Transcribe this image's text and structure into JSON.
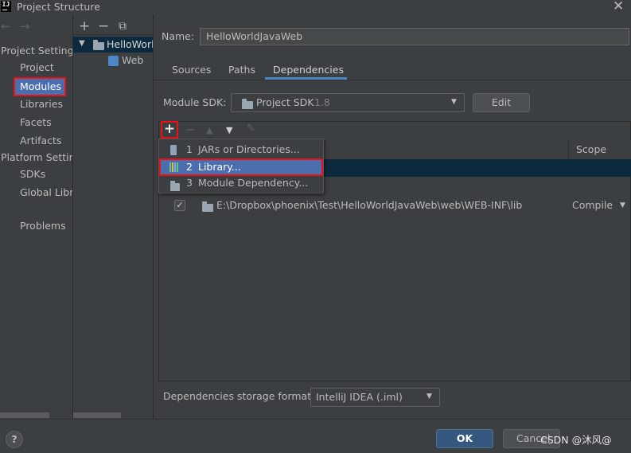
{
  "window": {
    "title": "Project Structure",
    "app_icon_text": "IJ"
  },
  "sidebar": {
    "project_settings_header": "Project Settings",
    "project_settings_items": [
      "Project",
      "Modules",
      "Libraries",
      "Facets",
      "Artifacts"
    ],
    "platform_settings_header": "Platform Settings",
    "platform_settings_items": [
      "SDKs",
      "Global Libraries"
    ],
    "problems": "Problems"
  },
  "tree": {
    "toolbar": {
      "add": "+",
      "remove": "−",
      "copy": "⧉"
    },
    "module": "HelloWorldJavaWeb",
    "child": "Web"
  },
  "main": {
    "name_label": "Name:",
    "name_value": "HelloWorldJavaWeb",
    "tabs": [
      "Sources",
      "Paths",
      "Dependencies"
    ],
    "active_tab": "Dependencies",
    "module_sdk_label": "Module SDK:",
    "module_sdk_value": "Project SDK",
    "module_sdk_version": "1.8",
    "edit_button": "Edit",
    "table": {
      "scope_header": "Scope",
      "rows": [
        {
          "checked": true,
          "path": "E:\\Dropbox\\phoenix\\Test\\HelloWorldJavaWeb\\web\\WEB-INF\\lib",
          "scope": "Compile"
        }
      ]
    },
    "add_menu": [
      {
        "number": "1",
        "label": "JARs or Directories..."
      },
      {
        "number": "2",
        "label": "Library..."
      },
      {
        "number": "3",
        "label": "Module Dependency..."
      }
    ],
    "storage_label": "Dependencies storage format:",
    "storage_value": "IntelliJ IDEA (.iml)"
  },
  "footer": {
    "help": "?",
    "ok": "OK",
    "cancel": "Cancel"
  },
  "watermark": "CSDN @沐风@",
  "colors": {
    "selection": "#4b6eaf",
    "highlight": "#e11111",
    "ok_button": "#365880",
    "row_selection": "#0d293e"
  }
}
